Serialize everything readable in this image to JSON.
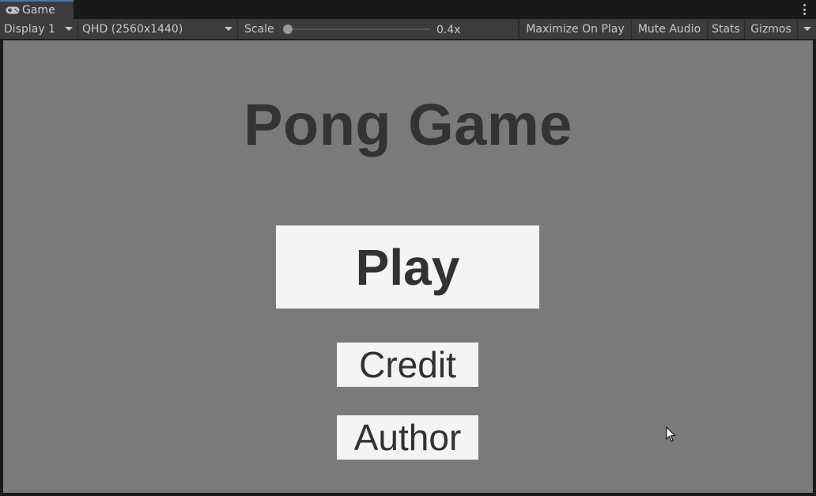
{
  "tab": {
    "label": "Game",
    "icon": "gamepad-icon"
  },
  "toolbar": {
    "display": "Display 1",
    "resolution": "QHD (2560x1440)",
    "scale_label": "Scale",
    "scale_value": "0.4x",
    "scale_fraction": 0.0,
    "maximize_on_play": "Maximize On Play",
    "mute_audio": "Mute Audio",
    "stats": "Stats",
    "gizmos": "Gizmos"
  },
  "game": {
    "title": "Pong Game",
    "buttons": {
      "play": "Play",
      "credit": "Credit",
      "author": "Author"
    },
    "colors": {
      "background": "#7a7a7a",
      "button": "#f4f4f4",
      "text": "#333333"
    }
  }
}
